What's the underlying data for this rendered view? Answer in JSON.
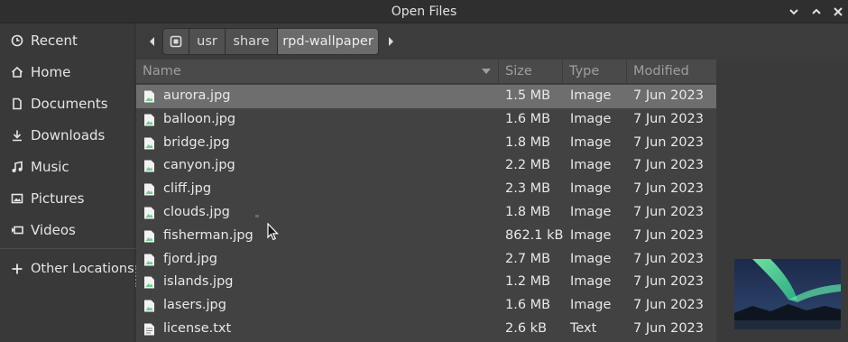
{
  "window": {
    "title": "Open Files"
  },
  "sidebar": {
    "items": [
      {
        "label": "Recent",
        "icon": "clock-icon"
      },
      {
        "label": "Home",
        "icon": "home-icon"
      },
      {
        "label": "Documents",
        "icon": "document-icon"
      },
      {
        "label": "Downloads",
        "icon": "download-icon"
      },
      {
        "label": "Music",
        "icon": "music-icon"
      },
      {
        "label": "Pictures",
        "icon": "picture-icon"
      },
      {
        "label": "Videos",
        "icon": "video-icon"
      }
    ],
    "other": {
      "label": "Other Locations",
      "icon": "plus-icon"
    }
  },
  "pathbar": {
    "segments": [
      "usr",
      "share",
      "rpd-wallpaper"
    ],
    "active": "rpd-wallpaper"
  },
  "columns": {
    "name": "Name",
    "size": "Size",
    "type": "Type",
    "modified": "Modified"
  },
  "files": [
    {
      "name": "aurora.jpg",
      "size": "1.5 MB",
      "type": "Image",
      "modified": "7 Jun 2023",
      "selected": true
    },
    {
      "name": "balloon.jpg",
      "size": "1.6 MB",
      "type": "Image",
      "modified": "7 Jun 2023"
    },
    {
      "name": "bridge.jpg",
      "size": "1.8 MB",
      "type": "Image",
      "modified": "7 Jun 2023"
    },
    {
      "name": "canyon.jpg",
      "size": "2.2 MB",
      "type": "Image",
      "modified": "7 Jun 2023"
    },
    {
      "name": "cliff.jpg",
      "size": "2.3 MB",
      "type": "Image",
      "modified": "7 Jun 2023"
    },
    {
      "name": "clouds.jpg",
      "size": "1.8 MB",
      "type": "Image",
      "modified": "7 Jun 2023"
    },
    {
      "name": "fisherman.jpg",
      "size": "862.1 kB",
      "type": "Image",
      "modified": "7 Jun 2023"
    },
    {
      "name": "fjord.jpg",
      "size": "2.7 MB",
      "type": "Image",
      "modified": "7 Jun 2023"
    },
    {
      "name": "islands.jpg",
      "size": "1.2 MB",
      "type": "Image",
      "modified": "7 Jun 2023"
    },
    {
      "name": "lasers.jpg",
      "size": "1.6 MB",
      "type": "Image",
      "modified": "7 Jun 2023"
    },
    {
      "name": "license.txt",
      "size": "2.6 kB",
      "type": "Text",
      "modified": "7 Jun 2023"
    }
  ],
  "colors": {
    "selected_row": "#6e6e6e",
    "accent_green": "#6ecf8e"
  }
}
